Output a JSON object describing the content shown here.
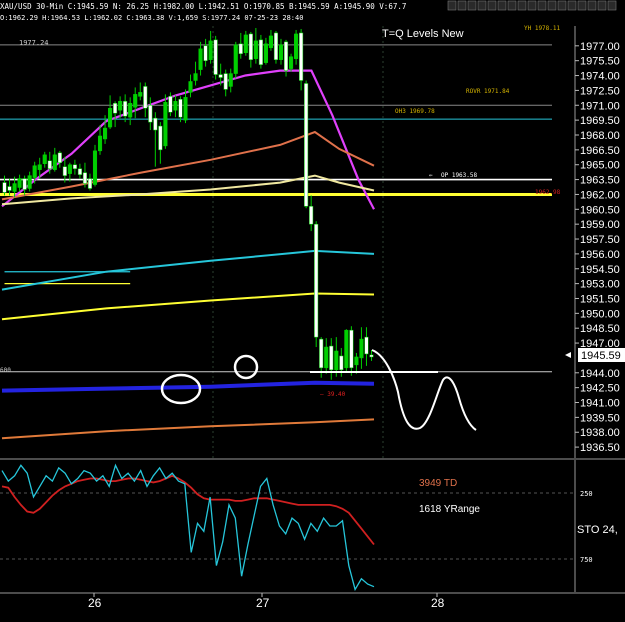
{
  "header": {
    "symbol_text": "XAU/USD 30-Min C:1945.59 N: 26.25 H:1982.00 L:1942.51 O:1970.85 B:1945.59 A:1945.90 V:67.7",
    "sub_text": "O:1962.29 H:1964.53 L:1962.02 C:1963.38 V:1,659 S:1977.24 07-25-23 28:40"
  },
  "toolbar": {
    "buttons": [
      "",
      "",
      "",
      "",
      "",
      "",
      "",
      "",
      "",
      "",
      "",
      "",
      "",
      "",
      "",
      "",
      ""
    ]
  },
  "chart_data": [
    {
      "type": "candlestick",
      "title": "T=Q Levels New",
      "annotations": {
        "top_left": "1977.24",
        "yh": "YH 1978.11",
        "rovr": "ROVR 1971.84",
        "oh3": "OH3 1969.78",
        "op": "OP 1963.58",
        "dash": "— 39.40",
        "left_line": "600",
        "right_yellow": "1962.98"
      },
      "current_price": "1945.59",
      "ylim": [
        1935.4,
        1979
      ],
      "y_ticks": [
        "1977.00",
        "1975.50",
        "1974.00",
        "1972.50",
        "1971.00",
        "1969.50",
        "1968.00",
        "1966.50",
        "1965.00",
        "1963.50",
        "1962.00",
        "1960.50",
        "1959.00",
        "1957.50",
        "1956.00",
        "1954.50",
        "1953.00",
        "1951.50",
        "1950.00",
        "1948.50",
        "1947.00",
        "1944.00",
        "1942.50",
        "1941.00",
        "1939.50",
        "1938.00",
        "1936.50"
      ],
      "x_labels": [
        "26",
        "27",
        "28"
      ],
      "candles": [
        [
          1963.2,
          1962.2,
          1961.9,
          1963.9
        ],
        [
          1962.8,
          1962.4,
          1961.9,
          1963.6
        ],
        [
          1962.3,
          1963.1,
          1961.7,
          1963.8
        ],
        [
          1962.7,
          1963.6,
          1962.3,
          1964.0
        ],
        [
          1963.6,
          1962.5,
          1961.9,
          1963.9
        ],
        [
          1962.6,
          1963.9,
          1962.3,
          1964.3
        ],
        [
          1963.7,
          1964.9,
          1963.1,
          1965.3
        ],
        [
          1964.5,
          1965.0,
          1963.6,
          1965.7
        ],
        [
          1965.1,
          1966.0,
          1964.7,
          1966.3
        ],
        [
          1965.4,
          1964.6,
          1964.1,
          1966.3
        ],
        [
          1964.5,
          1966.0,
          1964.3,
          1966.7
        ],
        [
          1966.2,
          1965.2,
          1964.7,
          1966.4
        ],
        [
          1964.8,
          1963.9,
          1963.2,
          1965.8
        ],
        [
          1964.1,
          1965.0,
          1963.3,
          1965.2
        ],
        [
          1965.0,
          1964.6,
          1964.0,
          1965.5
        ],
        [
          1964.6,
          1964.0,
          1963.6,
          1965.1
        ],
        [
          1964.2,
          1963.1,
          1962.7,
          1965.2
        ],
        [
          1963.6,
          1962.6,
          1962.4,
          1964.1
        ],
        [
          1963.0,
          1966.4,
          1962.8,
          1967.0
        ],
        [
          1966.4,
          1967.9,
          1966.0,
          1969.0
        ],
        [
          1967.6,
          1968.7,
          1967.1,
          1970.0
        ],
        [
          1968.8,
          1970.7,
          1968.6,
          1972.0
        ],
        [
          1971.2,
          1970.2,
          1968.8,
          1971.4
        ],
        [
          1970.5,
          1971.4,
          1969.7,
          1971.9
        ],
        [
          1971.4,
          1969.9,
          1969.3,
          1972.1
        ],
        [
          1969.8,
          1971.2,
          1969.0,
          1971.8
        ],
        [
          1970.8,
          1972.1,
          1969.7,
          1972.8
        ],
        [
          1971.9,
          1972.3,
          1971.5,
          1973.3
        ],
        [
          1972.9,
          1970.7,
          1969.8,
          1973.3
        ],
        [
          1971.0,
          1969.3,
          1968.5,
          1971.8
        ],
        [
          1969.7,
          1968.5,
          1964.8,
          1970.3
        ],
        [
          1968.9,
          1966.5,
          1965.1,
          1969.3
        ],
        [
          1966.9,
          1971.3,
          1966.6,
          1972.1
        ],
        [
          1971.9,
          1970.3,
          1969.9,
          1972.3
        ],
        [
          1970.5,
          1971.4,
          1969.8,
          1972.0
        ],
        [
          1971.6,
          1969.8,
          1969.3,
          1971.9
        ],
        [
          1969.5,
          1971.8,
          1969.2,
          1972.6
        ],
        [
          1972.3,
          1973.4,
          1971.8,
          1974.1
        ],
        [
          1973.5,
          1974.2,
          1973.0,
          1975.4
        ],
        [
          1974.6,
          1976.7,
          1974.0,
          1977.4
        ],
        [
          1977.0,
          1975.5,
          1974.9,
          1977.7
        ],
        [
          1975.6,
          1977.5,
          1975.2,
          1978.5
        ],
        [
          1977.6,
          1974.1,
          1973.6,
          1978.0
        ],
        [
          1974.1,
          1973.8,
          1973.0,
          1975.2
        ],
        [
          1974.2,
          1972.6,
          1971.9,
          1974.6
        ],
        [
          1972.9,
          1974.2,
          1972.3,
          1974.7
        ],
        [
          1974.2,
          1977.1,
          1973.7,
          1977.4
        ],
        [
          1977.2,
          1976.2,
          1975.7,
          1978.3
        ],
        [
          1976.3,
          1978.1,
          1976.0,
          1978.5
        ],
        [
          1978.2,
          1975.6,
          1974.8,
          1978.4
        ],
        [
          1975.7,
          1977.5,
          1975.2,
          1978.8
        ],
        [
          1977.6,
          1975.1,
          1974.7,
          1978.1
        ],
        [
          1975.3,
          1977.2,
          1975.1,
          1977.8
        ],
        [
          1976.8,
          1978.0,
          1976.5,
          1978.6
        ],
        [
          1978.3,
          1975.6,
          1975.2,
          1978.5
        ],
        [
          1975.6,
          1977.1,
          1975.1,
          1977.7
        ],
        [
          1977.4,
          1974.5,
          1973.9,
          1977.6
        ],
        [
          1974.7,
          1975.9,
          1974.4,
          1976.2
        ],
        [
          1975.7,
          1978.2,
          1975.1,
          1978.6
        ],
        [
          1978.3,
          1973.5,
          1972.5,
          1978.7
        ],
        [
          1973.2,
          1960.8,
          1960.6,
          1973.5
        ],
        [
          1960.8,
          1959.0,
          1958.3,
          1961.9
        ],
        [
          1959.0,
          1947.6,
          1946.6,
          1959.3
        ],
        [
          1947.4,
          1944.5,
          1943.5,
          1947.6
        ],
        [
          1944.5,
          1946.6,
          1943.9,
          1947.5
        ],
        [
          1946.7,
          1944.3,
          1943.3,
          1947.5
        ],
        [
          1944.3,
          1946.2,
          1943.6,
          1947.6
        ],
        [
          1945.7,
          1944.3,
          1943.6,
          1946.5
        ],
        [
          1944.5,
          1948.3,
          1944.0,
          1948.4
        ],
        [
          1948.3,
          1944.5,
          1943.7,
          1948.7
        ],
        [
          1944.8,
          1945.6,
          1943.9,
          1946.0
        ],
        [
          1945.5,
          1947.4,
          1944.4,
          1948.6
        ],
        [
          1947.6,
          1945.9,
          1944.7,
          1948.6
        ],
        [
          1945.8,
          1945.6,
          1945.2,
          1946.3
        ]
      ],
      "horizontal_levels": [
        {
          "value": 1977.1,
          "color": "#888888"
        },
        {
          "value": 1971.0,
          "color": "#888888"
        },
        {
          "value": 1969.6,
          "color": "#26c6da"
        },
        {
          "value": 1963.5,
          "color": "#ffffff"
        },
        {
          "value": 1962.0,
          "color": "#ffff33"
        },
        {
          "value": 1944.1,
          "color": "#cccccc"
        }
      ],
      "series": [
        {
          "color": "#e040fb",
          "points": [
            [
              0,
              1960.8
            ],
            [
              20,
              1963.6
            ],
            [
              40,
              1966.1
            ],
            [
              60,
              1969.4
            ],
            [
              80,
              1970.7
            ],
            [
              100,
              1972.0
            ],
            [
              120,
              1973.0
            ],
            [
              140,
              1974.0
            ],
            [
              160,
              1974.5
            ],
            [
              178,
              1974.5
            ],
            [
              190,
              1970.0
            ],
            [
              205,
              1963.5
            ],
            [
              214,
              1960.5
            ]
          ]
        },
        {
          "color": "#e0714b",
          "points": [
            [
              0,
              1961.5
            ],
            [
              40,
              1962.8
            ],
            [
              80,
              1964.2
            ],
            [
              120,
              1965.5
            ],
            [
              160,
              1967.0
            ],
            [
              180,
              1968.3
            ],
            [
              194,
              1966.6
            ],
            [
              214,
              1964.9
            ]
          ]
        },
        {
          "color": "#f0e8a0",
          "points": [
            [
              0,
              1961.0
            ],
            [
              40,
              1961.6
            ],
            [
              80,
              1962.0
            ],
            [
              120,
              1962.5
            ],
            [
              160,
              1963.2
            ],
            [
              180,
              1963.9
            ],
            [
              194,
              1963.2
            ],
            [
              214,
              1962.4
            ]
          ]
        },
        {
          "color": "#26c6da",
          "points": [
            [
              0,
              1952.4
            ],
            [
              60,
              1954.2
            ],
            [
              120,
              1955.3
            ],
            [
              180,
              1956.3
            ],
            [
              214,
              1956.0
            ]
          ]
        },
        {
          "color": "#ffff33",
          "points": [
            [
              0,
              1949.4
            ],
            [
              60,
              1950.5
            ],
            [
              120,
              1951.3
            ],
            [
              180,
              1952.0
            ],
            [
              214,
              1951.9
            ]
          ]
        },
        {
          "color": "#2323e0",
          "points": [
            [
              0,
              1942.2
            ],
            [
              60,
              1942.4
            ],
            [
              120,
              1942.6
            ],
            [
              180,
              1943.0
            ],
            [
              214,
              1942.9
            ]
          ]
        },
        {
          "color": "#e07a3a",
          "points": [
            [
              0,
              1937.4
            ],
            [
              60,
              1938.1
            ],
            [
              120,
              1938.6
            ],
            [
              180,
              1939.0
            ],
            [
              214,
              1939.3
            ]
          ]
        }
      ],
      "short_lines": [
        {
          "value": 1954.2,
          "from": 0,
          "to": 25,
          "color": "#26c6da"
        },
        {
          "value": 1953.0,
          "from": 0,
          "to": 25,
          "color": "#ffff33"
        }
      ]
    },
    {
      "type": "line",
      "title": "",
      "annotations": {
        "td": "3949 TD",
        "yrange": "1618 YRange",
        "sto": "STO 24,"
      },
      "ylim": [
        0,
        100
      ],
      "y_ticks": [
        "250",
        "750"
      ],
      "series": [
        {
          "color": "#d02020",
          "values": [
            80,
            79,
            72,
            66,
            61,
            60,
            63,
            68,
            73,
            77,
            80,
            82,
            84,
            85,
            86,
            86,
            85,
            84,
            84,
            85,
            86,
            86,
            85,
            84,
            83,
            84,
            86,
            88,
            86,
            83,
            79,
            74,
            71,
            70,
            70,
            70,
            70,
            69,
            69,
            70,
            71,
            71,
            71,
            70,
            69,
            68,
            67,
            66,
            66,
            66,
            66,
            66,
            66,
            65,
            63,
            60,
            54,
            48,
            42,
            36
          ]
        },
        {
          "color": "#26c6da",
          "values": [
            92,
            84,
            88,
            96,
            90,
            72,
            80,
            88,
            84,
            94,
            90,
            82,
            86,
            92,
            90,
            84,
            88,
            80,
            96,
            86,
            90,
            84,
            92,
            80,
            88,
            94,
            86,
            90,
            84,
            82,
            30,
            52,
            46,
            72,
            20,
            38,
            66,
            56,
            12,
            36,
            58,
            80,
            86,
            66,
            50,
            44,
            56,
            52,
            40,
            52,
            46,
            56,
            50,
            50,
            54,
            20,
            2,
            10,
            6,
            4
          ]
        }
      ]
    }
  ],
  "x_axis": {
    "labels": [
      "26",
      "27",
      "28"
    ]
  }
}
